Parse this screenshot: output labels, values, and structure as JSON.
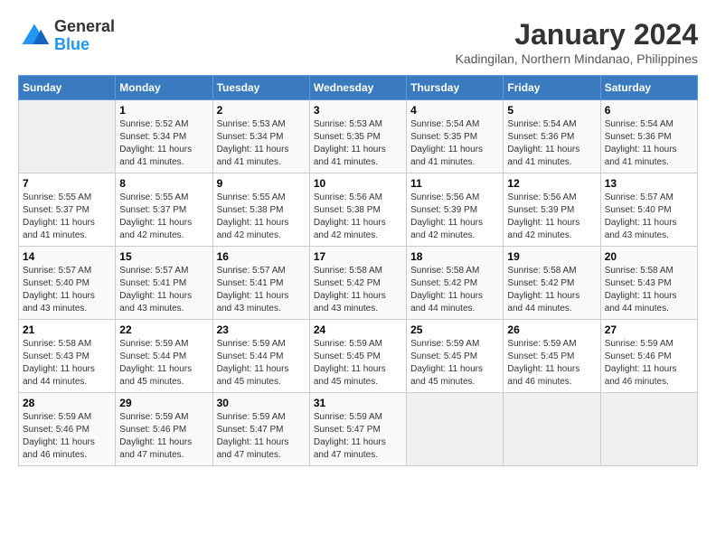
{
  "header": {
    "logo_general": "General",
    "logo_blue": "Blue",
    "month": "January 2024",
    "location": "Kadingilan, Northern Mindanao, Philippines"
  },
  "weekdays": [
    "Sunday",
    "Monday",
    "Tuesday",
    "Wednesday",
    "Thursday",
    "Friday",
    "Saturday"
  ],
  "weeks": [
    [
      {
        "day": "",
        "info": ""
      },
      {
        "day": "1",
        "info": "Sunrise: 5:52 AM\nSunset: 5:34 PM\nDaylight: 11 hours\nand 41 minutes."
      },
      {
        "day": "2",
        "info": "Sunrise: 5:53 AM\nSunset: 5:34 PM\nDaylight: 11 hours\nand 41 minutes."
      },
      {
        "day": "3",
        "info": "Sunrise: 5:53 AM\nSunset: 5:35 PM\nDaylight: 11 hours\nand 41 minutes."
      },
      {
        "day": "4",
        "info": "Sunrise: 5:54 AM\nSunset: 5:35 PM\nDaylight: 11 hours\nand 41 minutes."
      },
      {
        "day": "5",
        "info": "Sunrise: 5:54 AM\nSunset: 5:36 PM\nDaylight: 11 hours\nand 41 minutes."
      },
      {
        "day": "6",
        "info": "Sunrise: 5:54 AM\nSunset: 5:36 PM\nDaylight: 11 hours\nand 41 minutes."
      }
    ],
    [
      {
        "day": "7",
        "info": "Sunrise: 5:55 AM\nSunset: 5:37 PM\nDaylight: 11 hours\nand 41 minutes."
      },
      {
        "day": "8",
        "info": "Sunrise: 5:55 AM\nSunset: 5:37 PM\nDaylight: 11 hours\nand 42 minutes."
      },
      {
        "day": "9",
        "info": "Sunrise: 5:55 AM\nSunset: 5:38 PM\nDaylight: 11 hours\nand 42 minutes."
      },
      {
        "day": "10",
        "info": "Sunrise: 5:56 AM\nSunset: 5:38 PM\nDaylight: 11 hours\nand 42 minutes."
      },
      {
        "day": "11",
        "info": "Sunrise: 5:56 AM\nSunset: 5:39 PM\nDaylight: 11 hours\nand 42 minutes."
      },
      {
        "day": "12",
        "info": "Sunrise: 5:56 AM\nSunset: 5:39 PM\nDaylight: 11 hours\nand 42 minutes."
      },
      {
        "day": "13",
        "info": "Sunrise: 5:57 AM\nSunset: 5:40 PM\nDaylight: 11 hours\nand 43 minutes."
      }
    ],
    [
      {
        "day": "14",
        "info": "Sunrise: 5:57 AM\nSunset: 5:40 PM\nDaylight: 11 hours\nand 43 minutes."
      },
      {
        "day": "15",
        "info": "Sunrise: 5:57 AM\nSunset: 5:41 PM\nDaylight: 11 hours\nand 43 minutes."
      },
      {
        "day": "16",
        "info": "Sunrise: 5:57 AM\nSunset: 5:41 PM\nDaylight: 11 hours\nand 43 minutes."
      },
      {
        "day": "17",
        "info": "Sunrise: 5:58 AM\nSunset: 5:42 PM\nDaylight: 11 hours\nand 43 minutes."
      },
      {
        "day": "18",
        "info": "Sunrise: 5:58 AM\nSunset: 5:42 PM\nDaylight: 11 hours\nand 44 minutes."
      },
      {
        "day": "19",
        "info": "Sunrise: 5:58 AM\nSunset: 5:42 PM\nDaylight: 11 hours\nand 44 minutes."
      },
      {
        "day": "20",
        "info": "Sunrise: 5:58 AM\nSunset: 5:43 PM\nDaylight: 11 hours\nand 44 minutes."
      }
    ],
    [
      {
        "day": "21",
        "info": "Sunrise: 5:58 AM\nSunset: 5:43 PM\nDaylight: 11 hours\nand 44 minutes."
      },
      {
        "day": "22",
        "info": "Sunrise: 5:59 AM\nSunset: 5:44 PM\nDaylight: 11 hours\nand 45 minutes."
      },
      {
        "day": "23",
        "info": "Sunrise: 5:59 AM\nSunset: 5:44 PM\nDaylight: 11 hours\nand 45 minutes."
      },
      {
        "day": "24",
        "info": "Sunrise: 5:59 AM\nSunset: 5:45 PM\nDaylight: 11 hours\nand 45 minutes."
      },
      {
        "day": "25",
        "info": "Sunrise: 5:59 AM\nSunset: 5:45 PM\nDaylight: 11 hours\nand 45 minutes."
      },
      {
        "day": "26",
        "info": "Sunrise: 5:59 AM\nSunset: 5:45 PM\nDaylight: 11 hours\nand 46 minutes."
      },
      {
        "day": "27",
        "info": "Sunrise: 5:59 AM\nSunset: 5:46 PM\nDaylight: 11 hours\nand 46 minutes."
      }
    ],
    [
      {
        "day": "28",
        "info": "Sunrise: 5:59 AM\nSunset: 5:46 PM\nDaylight: 11 hours\nand 46 minutes."
      },
      {
        "day": "29",
        "info": "Sunrise: 5:59 AM\nSunset: 5:46 PM\nDaylight: 11 hours\nand 47 minutes."
      },
      {
        "day": "30",
        "info": "Sunrise: 5:59 AM\nSunset: 5:47 PM\nDaylight: 11 hours\nand 47 minutes."
      },
      {
        "day": "31",
        "info": "Sunrise: 5:59 AM\nSunset: 5:47 PM\nDaylight: 11 hours\nand 47 minutes."
      },
      {
        "day": "",
        "info": ""
      },
      {
        "day": "",
        "info": ""
      },
      {
        "day": "",
        "info": ""
      }
    ]
  ]
}
